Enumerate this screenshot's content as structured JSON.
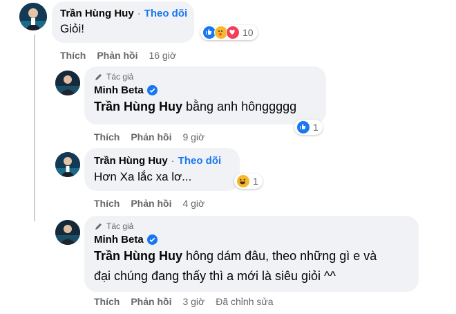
{
  "comments": [
    {
      "name": "Trần Hùng Huy",
      "follow": "Theo dõi",
      "text": "Giỏi!",
      "reaction_count": "10",
      "like": "Thích",
      "reply": "Phản hồi",
      "time": "16 giờ"
    },
    {
      "author_tag": "Tác giả",
      "name": "Minh Beta",
      "mention": "Trần Hùng Huy",
      "text": " bằng anh hônggggg",
      "reaction_count": "1",
      "like": "Thích",
      "reply": "Phản hồi",
      "time": "9 giờ"
    },
    {
      "name": "Trần Hùng Huy",
      "follow": "Theo dõi",
      "text": "Hơn Xa lắc xa lơ...",
      "reaction_count": "1",
      "like": "Thích",
      "reply": "Phản hồi",
      "time": "4 giờ"
    },
    {
      "author_tag": "Tác giả",
      "name": "Minh Beta",
      "mention": "Trần Hùng Huy",
      "text_line1": " hông dám đâu, theo những gì e và",
      "text_line2": "đại chúng đang thấy thì a mới là siêu giỏi ^^",
      "like": "Thích",
      "reply": "Phản hồi",
      "time": "3 giờ",
      "edited": "Đã chỉnh sửa"
    }
  ],
  "colors": {
    "bubble": "#f0f2f5",
    "accent": "#1877f2",
    "secondary_text": "#65676b"
  },
  "icons": [
    "avatar",
    "like-reaction-icon",
    "care-reaction-icon",
    "love-reaction-icon",
    "haha-reaction-icon",
    "pencil-icon",
    "verified-badge-icon"
  ]
}
